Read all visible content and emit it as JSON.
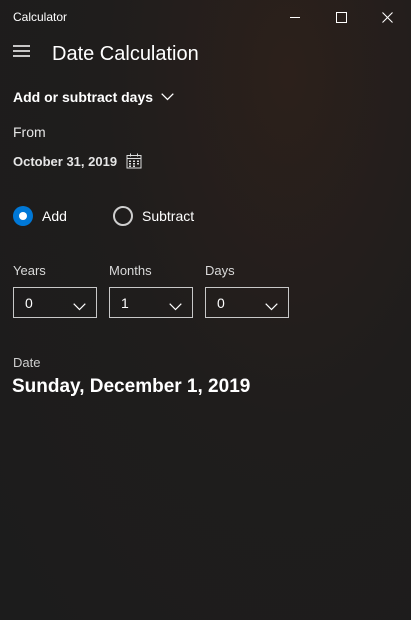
{
  "window": {
    "title": "Calculator",
    "controls": {
      "minimize_icon": "minimize-icon",
      "maximize_icon": "maximize-icon",
      "close_icon": "close-icon"
    }
  },
  "header": {
    "menu_icon": "hamburger-icon",
    "title": "Date Calculation"
  },
  "mode": {
    "selected": "Add or subtract days",
    "icon": "chevron-down-icon"
  },
  "from": {
    "label": "From",
    "date": "October 31, 2019",
    "icon": "calendar-icon"
  },
  "operation": {
    "options": [
      {
        "label": "Add",
        "checked": true
      },
      {
        "label": "Subtract",
        "checked": false
      }
    ]
  },
  "fields": [
    {
      "label": "Years",
      "value": "0"
    },
    {
      "label": "Months",
      "value": "1"
    },
    {
      "label": "Days",
      "value": "0"
    }
  ],
  "result": {
    "label": "Date",
    "value": "Sunday, December 1, 2019"
  },
  "colors": {
    "accent": "#0078d7",
    "background": "#1f1d1c",
    "text": "#ffffff"
  }
}
